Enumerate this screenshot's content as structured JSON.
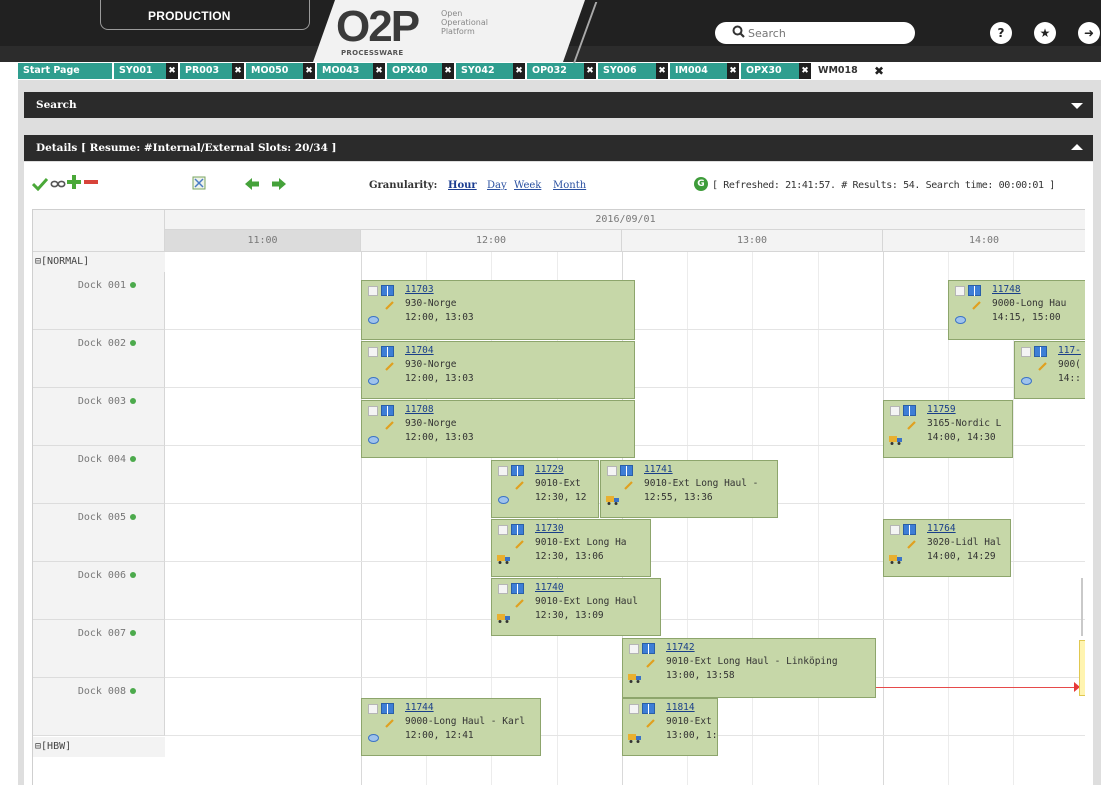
{
  "header": {
    "environment": "PRODUCTION",
    "logo_main": "O2P",
    "logo_tagline": "Open Operational Platform",
    "logo_brand": "PROCESSWARE",
    "search_placeholder": "Search",
    "buttons": {
      "help": "?",
      "favorites": "★",
      "logout": "➜"
    }
  },
  "tabs": [
    {
      "label": "Start Page",
      "closable": false
    },
    {
      "label": "SY001",
      "closable": true
    },
    {
      "label": "PR003",
      "closable": true
    },
    {
      "label": "MO050",
      "closable": true
    },
    {
      "label": "MO043",
      "closable": true
    },
    {
      "label": "OPX40",
      "closable": true
    },
    {
      "label": "SY042",
      "closable": true
    },
    {
      "label": "OP032",
      "closable": true
    },
    {
      "label": "SY006",
      "closable": true
    },
    {
      "label": "IM004",
      "closable": true
    },
    {
      "label": "OPX30",
      "closable": true
    },
    {
      "label": "WM018",
      "closable": true,
      "active": true
    }
  ],
  "search_panel": {
    "title": "Search"
  },
  "details_panel": {
    "title": "Details  [ Resume: #Internal/External Slots: 20/34 ]"
  },
  "toolbar": {
    "granularity_label": "Granularity:",
    "granularity": [
      "Hour",
      "Day",
      "Week",
      "Month"
    ],
    "granularity_active": "Hour",
    "refresh_icon": "G",
    "refresh_text": "[ Refreshed: 21:41:57. # Results: 54. Search time: 00:00:01 ]"
  },
  "grid": {
    "date": "2016/09/01",
    "hours": [
      "11:00",
      "12:00",
      "13:00",
      "14:00"
    ],
    "groups": [
      {
        "name": "[NORMAL]",
        "symbol": "⊟"
      },
      {
        "name": "[HBW]",
        "symbol": "⊟"
      }
    ],
    "docks": [
      "Dock 001",
      "Dock 002",
      "Dock 003",
      "Dock 004",
      "Dock 005",
      "Dock 006",
      "Dock 007",
      "Dock 008"
    ]
  },
  "slots": [
    {
      "id": "11703",
      "desc": "930-Norge",
      "time": "12:00, 13:03",
      "transport": "bubble"
    },
    {
      "id": "11748",
      "desc": "9000-Long Hau",
      "time": "14:15, 15:00",
      "transport": "bubble"
    },
    {
      "id": "11704",
      "desc": "930-Norge",
      "time": "12:00, 13:03",
      "transport": "bubble"
    },
    {
      "id": "117-",
      "desc": "900(",
      "time": "14::",
      "transport": "bubble"
    },
    {
      "id": "11708",
      "desc": "930-Norge",
      "time": "12:00, 13:03",
      "transport": "bubble"
    },
    {
      "id": "11759",
      "desc": "3165-Nordic L",
      "time": "14:00, 14:30",
      "transport": "truck"
    },
    {
      "id": "11729",
      "desc": "9010-Ext",
      "time": "12:30, 12",
      "transport": "bubble"
    },
    {
      "id": "11741",
      "desc": "9010-Ext Long Haul -",
      "time": "12:55, 13:36",
      "transport": "truck"
    },
    {
      "id": "11730",
      "desc": "9010-Ext Long Ha",
      "time": "12:30, 13:06",
      "transport": "truck"
    },
    {
      "id": "11764",
      "desc": "3020-Lidl Hal",
      "time": "14:00, 14:29",
      "transport": "truck"
    },
    {
      "id": "11740",
      "desc": "9010-Ext Long Haul",
      "time": "12:30, 13:09",
      "transport": "truck"
    },
    {
      "id": "11742",
      "desc": "9010-Ext Long Haul - Linköping",
      "time": "13:00, 13:58",
      "transport": "truck"
    },
    {
      "id": "11744",
      "desc": "9000-Long Haul - Karl",
      "time": "12:00, 12:41",
      "transport": "bubble"
    },
    {
      "id": "11814",
      "desc": "9010-Ext",
      "time": "13:00, 1:",
      "transport": "truck"
    }
  ],
  "colors": {
    "header_bg": "#212121",
    "tab_bg": "#2f9e8f",
    "slot_bg": "#c6d7a8",
    "link": "#1a3f8a",
    "dependency": "#e64a4a"
  }
}
